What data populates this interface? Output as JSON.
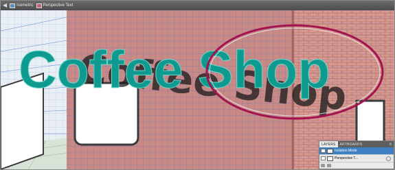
{
  "breadcrumb": {
    "items": [
      {
        "label": "Isometric",
        "icon": "layer-icon",
        "color": "#5b8fb9"
      },
      {
        "label": "Perspective Text",
        "icon": "layer-icon",
        "color": "#c0607a"
      }
    ]
  },
  "artwork": {
    "headline": "Coffee Shop",
    "headline_color": "#0f9a8f",
    "shadow_text": "Coffee Shop",
    "wall_color": "#c98a86",
    "brick_color": "#d89a90",
    "grid_color": "#3d6fd1",
    "highlight_color": "#a3134f"
  },
  "layers_panel": {
    "tabs": [
      "LAYERS",
      "ARTBOARDS"
    ],
    "rows": [
      {
        "label": "Isolation Mode",
        "selected": true
      },
      {
        "label": "Perspective T...",
        "selected": false
      }
    ]
  }
}
